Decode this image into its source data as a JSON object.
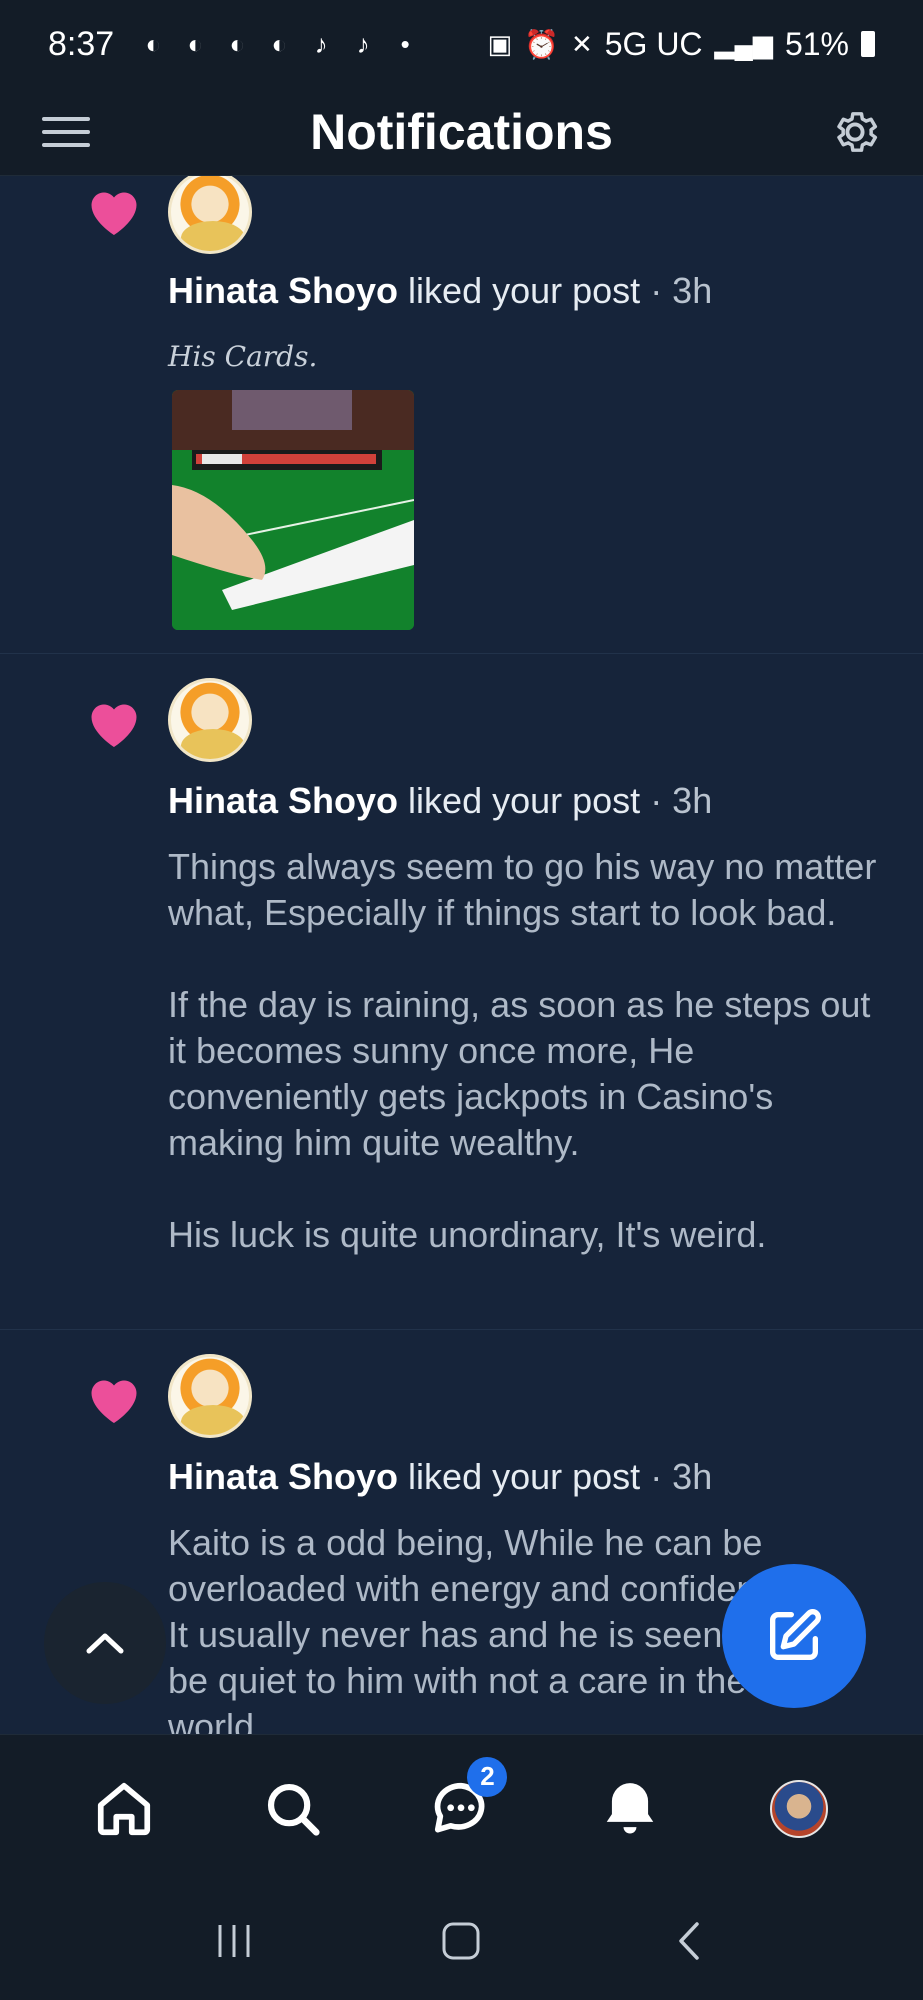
{
  "status_bar": {
    "time": "8:37",
    "network": "5G UC",
    "battery": "51%"
  },
  "header": {
    "title": "Notifications"
  },
  "notifications": [
    {
      "user": "Hinata Shoyo",
      "action": "liked your post",
      "time": "· 3h",
      "post_title": "His Cards."
    },
    {
      "user": "Hinata Shoyo",
      "action": "liked your post",
      "time": "· 3h",
      "paragraphs": [
        "Things always seem to go his way no matter what, Especially if things start to look bad.",
        "If the day is raining, as soon as he steps out it becomes sunny once more, He conveniently gets jackpots in Casino's making him quite wealthy.",
        "His luck is quite unordinary, It's weird."
      ]
    },
    {
      "user": "Hinata Shoyo",
      "action": "liked your post",
      "time": "· 3h",
      "text": "Kaito is a odd being, While he can be overloaded with energy and confidence, It usually never has and he is seen to be quiet to him with not a care in the world"
    }
  ],
  "bottom_nav": {
    "chat_badge": "2"
  },
  "colors": {
    "accent": "#1f6feb",
    "heart": "#ec4f9a",
    "background": "#16243a"
  }
}
